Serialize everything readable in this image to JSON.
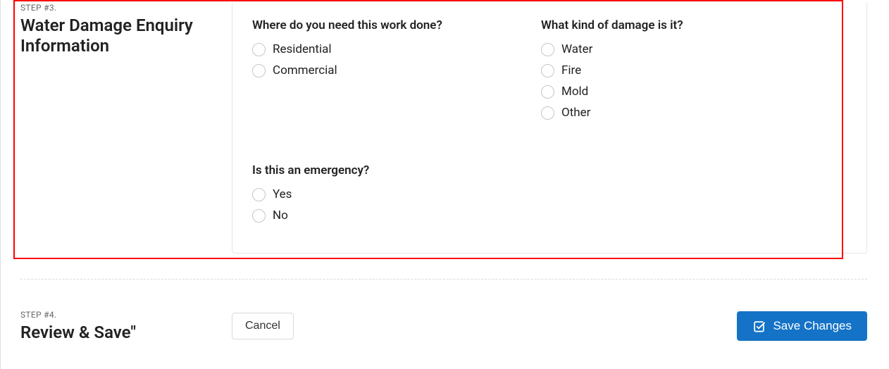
{
  "step3": {
    "step_label": "STEP #3.",
    "title": "Water Damage Enquiry Information",
    "questions": {
      "work_location": {
        "label": "Where do you need this work done?",
        "options": [
          "Residential",
          "Commercial"
        ]
      },
      "damage_kind": {
        "label": "What kind of damage is it?",
        "options": [
          "Water",
          "Fire",
          "Mold",
          "Other"
        ]
      },
      "emergency": {
        "label": "Is this an emergency?",
        "options": [
          "Yes",
          "No"
        ]
      }
    }
  },
  "step4": {
    "step_label": "STEP #4.",
    "title": "Review & Save\"",
    "buttons": {
      "cancel": "Cancel",
      "save": "Save Changes"
    }
  },
  "colors": {
    "primary": "#1473c6",
    "highlight_border": "#ff0000"
  }
}
